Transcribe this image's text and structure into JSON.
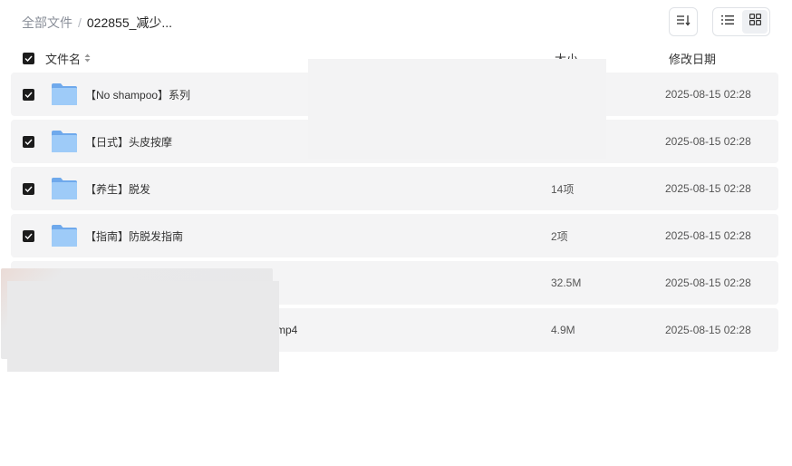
{
  "breadcrumb": {
    "root": "全部文件",
    "separator": "/",
    "current": "022855_减少..."
  },
  "columns": {
    "name": "文件名",
    "size": "大小",
    "date": "修改日期"
  },
  "rows": [
    {
      "name": "【No shampoo】系列",
      "size": "",
      "date": "2025-08-15 02:28",
      "type": "folder",
      "checked": true
    },
    {
      "name": "【日式】头皮按摩",
      "size": "",
      "date": "2025-08-15 02:28",
      "type": "folder",
      "checked": true
    },
    {
      "name": "【养生】脱发",
      "size": "14项",
      "date": "2025-08-15 02:28",
      "type": "folder",
      "checked": true
    },
    {
      "name": "【指南】防脱发指南",
      "size": "2项",
      "date": "2025-08-15 02:28",
      "type": "folder",
      "checked": true
    },
    {
      "name": "",
      "size": "32.5M",
      "date": "2025-08-15 02:28",
      "type": "file",
      "checked": false
    },
    {
      "name": "mp4",
      "size": "4.9M",
      "date": "2025-08-15 02:28",
      "type": "file",
      "checked": false
    }
  ],
  "colors": {
    "folder": "#7fb6f2",
    "checkbox": "#1c1c1c",
    "row_bg": "#f4f4f5"
  },
  "icons": {
    "sort": "sort-icon",
    "list_view": "list-view-icon",
    "grid_view": "grid-view-icon",
    "folder": "folder-icon"
  }
}
